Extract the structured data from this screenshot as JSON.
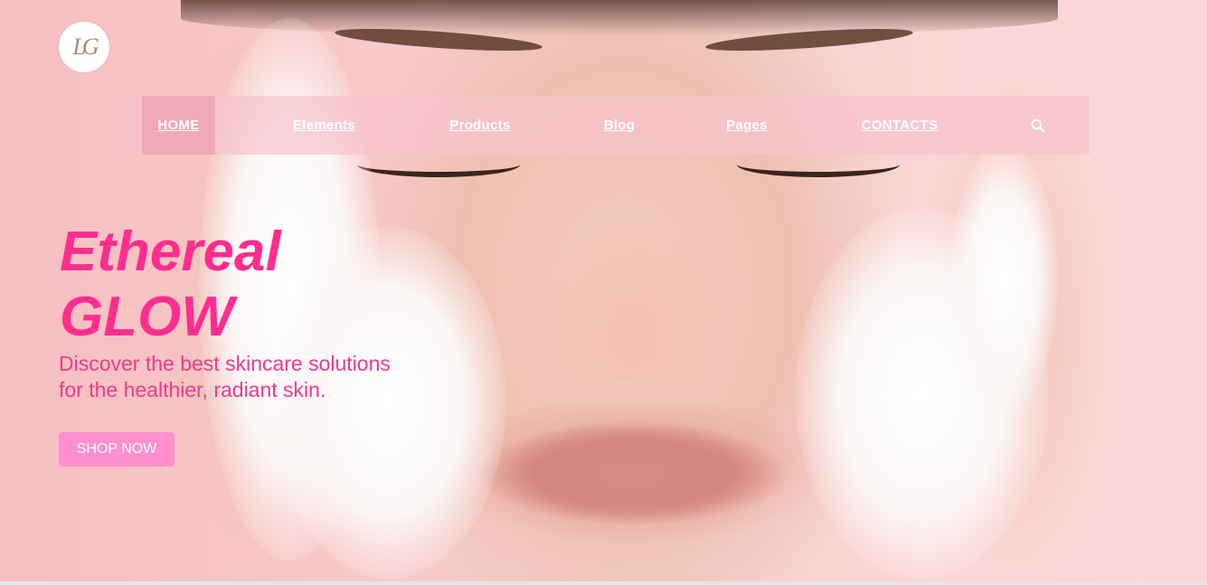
{
  "header": {
    "logo_text": "LG"
  },
  "nav": {
    "items": [
      {
        "label": "HOME",
        "active": true
      },
      {
        "label": "Elements",
        "active": false
      },
      {
        "label": "Products",
        "active": false
      },
      {
        "label": "Blog",
        "active": false
      },
      {
        "label": "Pages",
        "active": false
      },
      {
        "label": "CONTACTS",
        "active": false
      }
    ],
    "search_icon": "search-icon"
  },
  "hero": {
    "title_line1": "Ethereal",
    "title_line2": "GLOW",
    "subtitle_line1": "Discover the best skincare solutions",
    "subtitle_line2": "for the healthier, radiant skin.",
    "cta_label": "SHOP NOW"
  },
  "colors": {
    "accent": "#ff2d90",
    "button": "#ff8fcf",
    "nav_bg": "#f6c4cc",
    "nav_active": "#f0a9b6"
  }
}
